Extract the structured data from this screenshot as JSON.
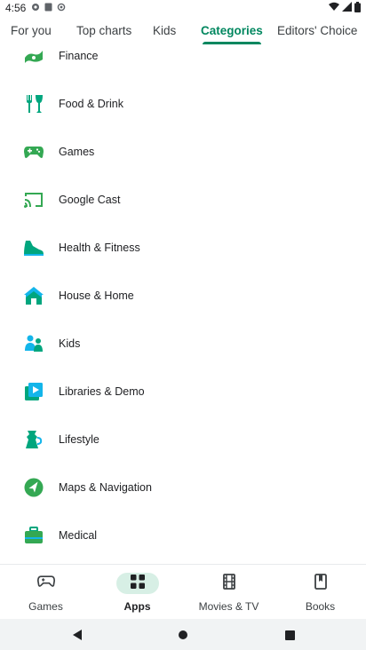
{
  "status_bar": {
    "time": "4:56"
  },
  "tabs": [
    {
      "label": "For you",
      "active": false
    },
    {
      "label": "Top charts",
      "active": false
    },
    {
      "label": "Kids",
      "active": false
    },
    {
      "label": "Categories",
      "active": true
    },
    {
      "label": "Editors' Choice",
      "active": false
    }
  ],
  "categories": [
    {
      "label": "Finance",
      "icon": "finance-icon"
    },
    {
      "label": "Food & Drink",
      "icon": "food-drink-icon"
    },
    {
      "label": "Games",
      "icon": "gamepad-icon"
    },
    {
      "label": "Google Cast",
      "icon": "cast-icon"
    },
    {
      "label": "Health & Fitness",
      "icon": "sneaker-icon"
    },
    {
      "label": "House & Home",
      "icon": "house-icon"
    },
    {
      "label": "Kids",
      "icon": "kids-icon"
    },
    {
      "label": "Libraries & Demo",
      "icon": "libraries-icon"
    },
    {
      "label": "Lifestyle",
      "icon": "coffee-pot-icon"
    },
    {
      "label": "Maps & Navigation",
      "icon": "map-icon"
    },
    {
      "label": "Medical",
      "icon": "medical-bag-icon"
    }
  ],
  "bottom_nav": [
    {
      "label": "Games",
      "icon": "gamepad-icon",
      "active": false
    },
    {
      "label": "Apps",
      "icon": "apps-grid-icon",
      "active": true
    },
    {
      "label": "Movies & TV",
      "icon": "film-icon",
      "active": false
    },
    {
      "label": "Books",
      "icon": "bookmark-icon",
      "active": false
    }
  ],
  "colors": {
    "accent": "#01875f",
    "accent_light": "#d7efe5",
    "icon_green": "#34a853",
    "icon_teal": "#00a67e",
    "icon_cyan": "#13b5ea"
  }
}
